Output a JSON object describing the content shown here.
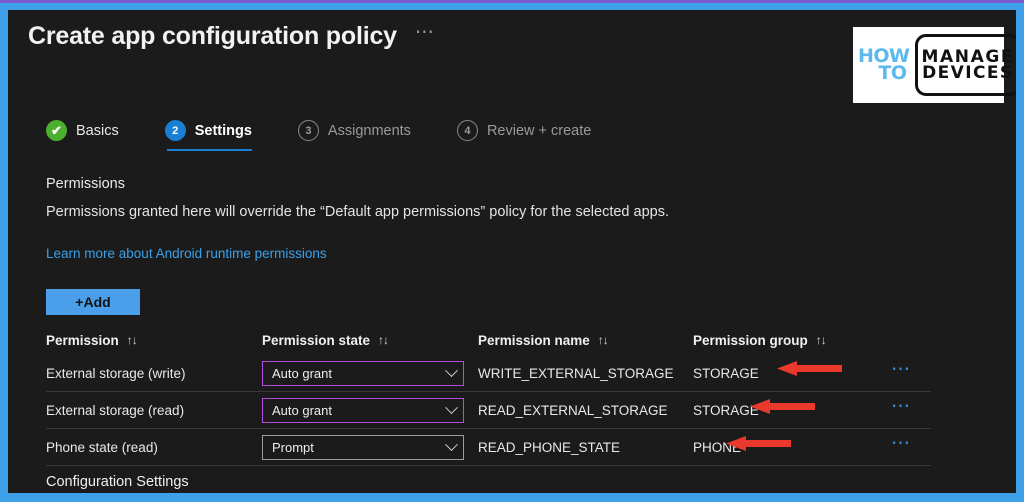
{
  "window": {
    "title": "Create app configuration policy",
    "title_menu_icon": "ellipsis-horizontal-icon"
  },
  "logo": {
    "line1": "HOW",
    "line2": "TO",
    "line3": "MANAGE",
    "line4": "DEVICES",
    "accent_color": "#5cb8ee"
  },
  "wizard": {
    "steps": [
      {
        "marker": "✔",
        "label": "Basics",
        "state": "done"
      },
      {
        "marker": "2",
        "label": "Settings",
        "state": "active"
      },
      {
        "marker": "3",
        "label": "Assignments",
        "state": "pending"
      },
      {
        "marker": "4",
        "label": "Review + create",
        "state": "pending"
      }
    ]
  },
  "content": {
    "section_heading": "Permissions",
    "section_description": "Permissions granted here will override the “Default app permissions” policy for the selected apps.",
    "learn_more_link": "Learn more about Android runtime permissions",
    "add_button": "+Add",
    "footer_heading": "Configuration Settings"
  },
  "table": {
    "sort_icon": "↑↓",
    "headers": [
      "Permission",
      "Permission state",
      "Permission name",
      "Permission group"
    ],
    "row_menu_icon": "ellipsis-horizontal-icon",
    "rows": [
      {
        "permission": "External storage (write)",
        "state": "Auto grant",
        "name": "WRITE_EXTERNAL_STORAGE",
        "group": "STORAGE",
        "state_highlighted": true
      },
      {
        "permission": "External storage (read)",
        "state": "Auto grant",
        "name": "READ_EXTERNAL_STORAGE",
        "group": "STORAGE",
        "state_highlighted": true
      },
      {
        "permission": "Phone state (read)",
        "state": "Prompt",
        "name": "READ_PHONE_STATE",
        "group": "PHONE",
        "state_highlighted": false
      }
    ]
  },
  "annotations": {
    "arrow_color": "#e8392c",
    "arrows": [
      {
        "target_row": 0,
        "points_to": "STORAGE"
      },
      {
        "target_row": 1,
        "points_to": "STORAGE"
      },
      {
        "target_row": 2,
        "points_to": "PHONE"
      }
    ]
  },
  "theme": {
    "frame_color": "#3da0e8",
    "frame_top_color": "#7b5ad0",
    "background": "#1b1b1b",
    "accent_blue": "#4a9eea",
    "link_blue": "#3aa0e8",
    "select_highlight": "#b44ee0",
    "step_done_green": "#4caf30",
    "step_active_blue": "#1a7fd4"
  }
}
